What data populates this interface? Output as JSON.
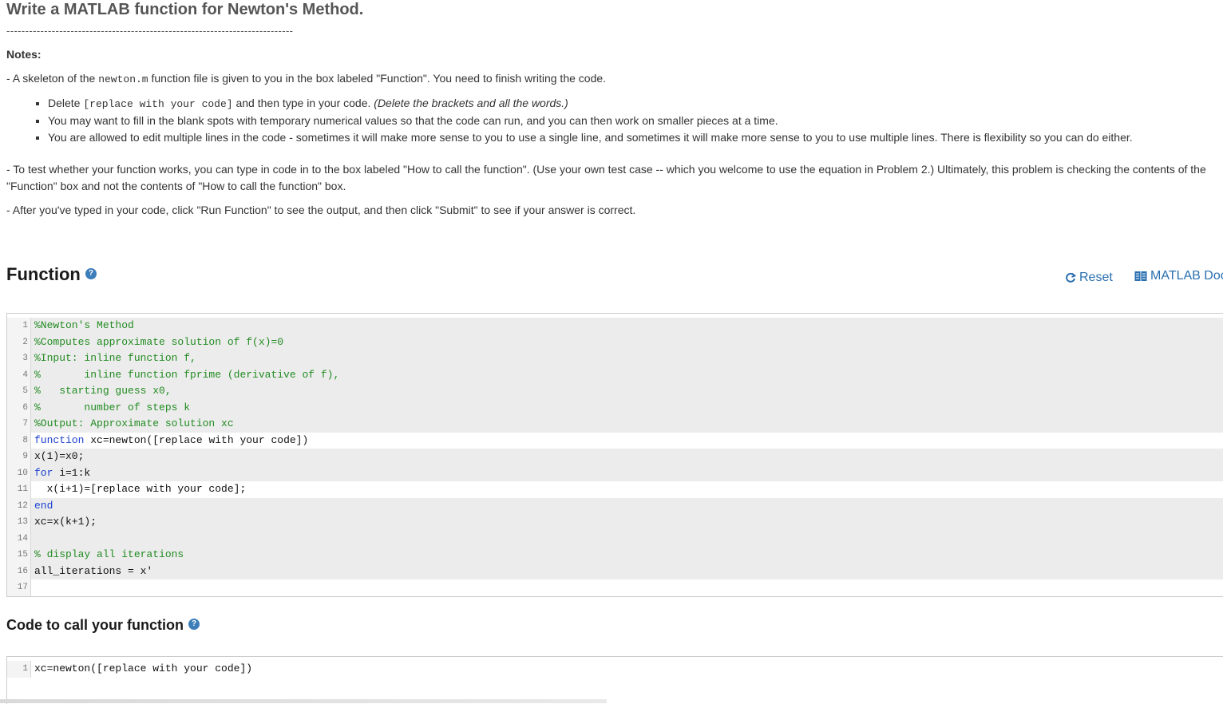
{
  "header": {
    "title": "Write a MATLAB function for Newton's Method.",
    "divider": "----------------------------------------------------------------------------"
  },
  "notes": {
    "label": "Notes:",
    "p1_prefix": "- A skeleton of the ",
    "p1_file": "newton.m",
    "p1_suffix": " function file is given to you in the box labeled \"Function\". You need to finish writing the code.",
    "bullets": [
      {
        "prefix": "Delete ",
        "code": "[replace with your code]",
        "middle": " and then type in your code. ",
        "italic": "(Delete the brackets and all the words.)"
      },
      {
        "text": "You may want to fill in the blank spots with temporary numerical values so that the code can run, and you can then work on smaller pieces at a time."
      },
      {
        "text": "You are allowed to edit multiple lines in the code - sometimes it will make more sense to you to use a single line, and sometimes it will make more sense to you to use multiple lines. There is flexibility so you can do either."
      }
    ],
    "p2": "- To test whether your function works, you can type in code in to the box labeled \"How to call the function\". (Use your own test case -- which you welcome to use the equation in Problem 2.) Ultimately, this problem is checking the contents of the \"Function\" box and not the contents of \"How to call the function\" box.",
    "p3": "- After you've typed in your code, click \"Run Function\" to see the output, and then click \"Submit\" to see if your answer is correct."
  },
  "function_section": {
    "title": "Function",
    "help_icon": "question-circle-icon",
    "reset_label": "Reset",
    "doc_label": "MATLAB Doc",
    "lines": [
      {
        "n": "1",
        "text": "%Newton's Method",
        "style": "cm",
        "editable": false
      },
      {
        "n": "2",
        "text": "%Computes approximate solution of f(x)=0",
        "style": "cm",
        "editable": false
      },
      {
        "n": "3",
        "text": "%Input: inline function f,",
        "style": "cm",
        "editable": false
      },
      {
        "n": "4",
        "text": "%       inline function fprime (derivative of f),",
        "style": "cm",
        "editable": false
      },
      {
        "n": "5",
        "text": "%   starting guess x0,",
        "style": "cm",
        "editable": false
      },
      {
        "n": "6",
        "text": "%       number of steps k",
        "style": "cm",
        "editable": false
      },
      {
        "n": "7",
        "text": "%Output: Approximate solution xc",
        "style": "cm",
        "editable": false
      },
      {
        "n": "8",
        "kw": "function",
        "text": " xc=newton([replace with your code])",
        "style": "tx",
        "editable": true
      },
      {
        "n": "9",
        "text": "x(1)=x0;",
        "style": "tx",
        "editable": false
      },
      {
        "n": "10",
        "kw": "for",
        "text": " i=1:k",
        "style": "tx",
        "editable": false
      },
      {
        "n": "11",
        "text": "  x(i+1)=[replace with your code];",
        "style": "tx",
        "editable": true
      },
      {
        "n": "12",
        "kw": "end",
        "text": "",
        "style": "tx",
        "editable": false
      },
      {
        "n": "13",
        "text": "xc=x(k+1);",
        "style": "tx",
        "editable": false
      },
      {
        "n": "14",
        "text": "",
        "style": "tx",
        "editable": false
      },
      {
        "n": "15",
        "text": "% display all iterations",
        "style": "cm",
        "editable": false
      },
      {
        "n": "16",
        "text": "all_iterations = x'",
        "style": "tx",
        "editable": false
      },
      {
        "n": "17",
        "text": "",
        "style": "tx",
        "editable": true
      }
    ]
  },
  "call_section": {
    "title": "Code to call your function",
    "help_icon": "question-circle-icon",
    "lines": [
      {
        "n": "1",
        "text": "xc=newton([replace with your code])",
        "style": "tx",
        "editable": true
      }
    ]
  },
  "colors": {
    "accent": "#2a6fb0",
    "comment": "#228b22",
    "keyword": "#1a3fd0",
    "readonly_bg": "#ececec"
  }
}
